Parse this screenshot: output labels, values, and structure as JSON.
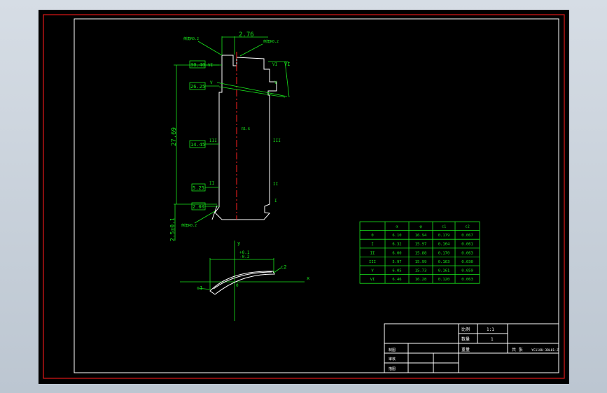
{
  "colors": {
    "frame_red": "#e01818",
    "line_green": "#19e61c",
    "centerline_red": "#ff2020",
    "outline_white": "#ffffff",
    "background": "#000000"
  },
  "dims": {
    "top": "2.76",
    "total_height": "27.69",
    "bottom": "2.5±0.1",
    "sections": [
      "30.40",
      "26.25",
      "14.45",
      "5.25",
      "2.00"
    ],
    "section_marks_left": [
      "VI",
      "V",
      "III",
      "II",
      "I"
    ],
    "section_marks_right": [
      "VI",
      "V",
      "III",
      "II",
      "I"
    ],
    "tolerance_top": "+0.1",
    "tolerance_bot": "-0.2",
    "note_tl": "倒角R0.2",
    "note_tr": "倒角R0.2",
    "note_bl": "倒角R0.2",
    "center_label": "R1.6",
    "axis_y": "y",
    "axis_x": "x",
    "c1": "c1",
    "c2": "c2",
    "origin": "0"
  },
  "table": {
    "headers": [
      "",
      "α",
      "φ",
      "c1",
      "c2"
    ],
    "rows": [
      [
        "0",
        "6.10",
        "16.94",
        "0.179",
        "0.067"
      ],
      [
        "I",
        "6.32",
        "15.97",
        "0.164",
        "0.061"
      ],
      [
        "II",
        "6.00",
        "15.88",
        "0.170",
        "0.063"
      ],
      [
        "III",
        "5.97",
        "15.99",
        "0.163",
        "0.030"
      ],
      [
        "V",
        "6.05",
        "15.73",
        "0.161",
        "0.059"
      ],
      [
        "VI",
        "6.46",
        "16.28",
        "0.120",
        "0.063"
      ]
    ]
  },
  "title_block": {
    "r1_label": "比例",
    "r1_value": "1:1",
    "r2_label": "数量",
    "r2_value": "1",
    "designer": "制图",
    "weight": "重量",
    "sheet": "共 张",
    "drawing_no": "YC118U-3BL01-Z",
    "checker": "审核",
    "approver": "描图"
  }
}
